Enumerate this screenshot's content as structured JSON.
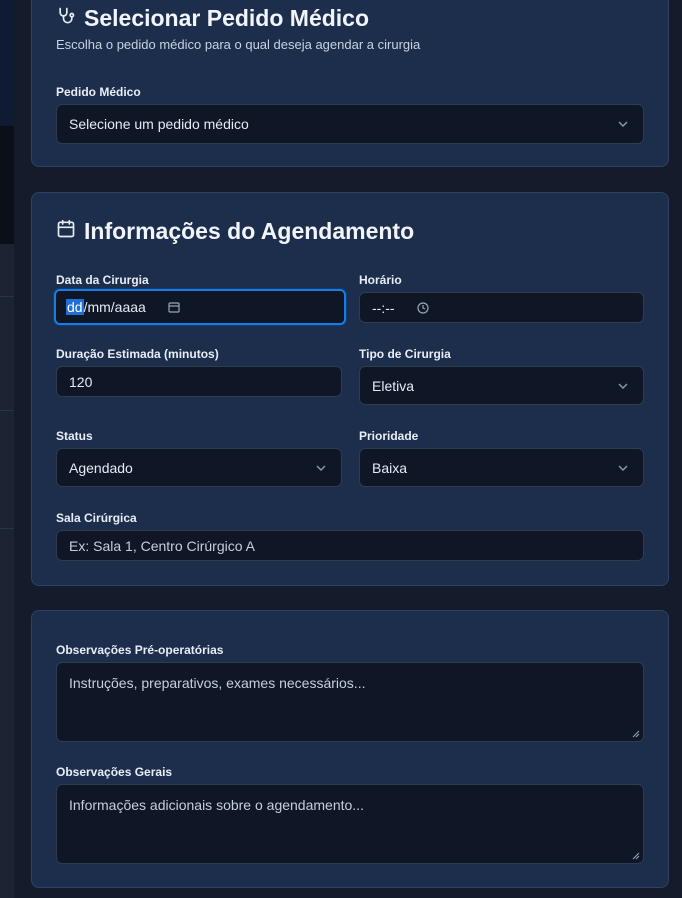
{
  "select_card": {
    "title": "Selecionar Pedido Médico",
    "subtitle": "Escolha o pedido médico para o qual deseja agendar a cirurgia",
    "field_label": "Pedido Médico",
    "field_value": "Selecione um pedido médico",
    "icon": "stethoscope-icon"
  },
  "schedule_card": {
    "title": "Informações do Agendamento",
    "icon": "calendar-icon",
    "date": {
      "label": "Data da Cirurgia",
      "segment_day": "dd",
      "rest": "/mm/aaaa"
    },
    "time": {
      "label": "Horário",
      "value": "--:--"
    },
    "duration": {
      "label": "Duração Estimada (minutos)",
      "value": "120"
    },
    "surgery_type": {
      "label": "Tipo de Cirurgia",
      "value": "Eletiva"
    },
    "status": {
      "label": "Status",
      "value": "Agendado"
    },
    "priority": {
      "label": "Prioridade",
      "value": "Baixa"
    },
    "room": {
      "label": "Sala Cirúrgica",
      "placeholder": "Ex: Sala 1, Centro Cirúrgico A"
    }
  },
  "notes_card": {
    "preop": {
      "label": "Observações Pré-operatórias",
      "placeholder": "Instruções, preparativos, exames necessários..."
    },
    "general": {
      "label": "Observações Gerais",
      "placeholder": "Informações adicionais sobre o agendamento..."
    }
  }
}
